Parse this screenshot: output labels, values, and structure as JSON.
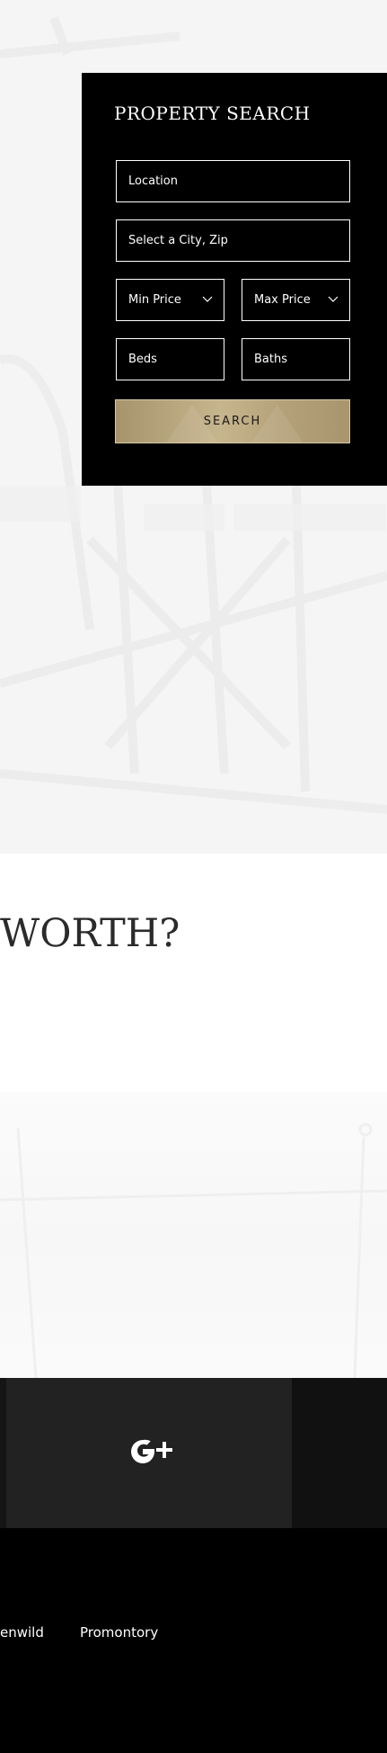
{
  "property_search": {
    "title": "PROPERTY SEARCH",
    "location_label": "Location",
    "city_zip_placeholder": "Select a City, Zip",
    "min_price_label": "Min Price",
    "max_price_label": "Max Price",
    "beds_label": "Beds",
    "baths_label": "Baths",
    "search_button": "SEARCH",
    "accent_color": "#b8a57c"
  },
  "worth_section": {
    "heading_fragment": "WORTH?"
  },
  "social": {
    "icons": [
      "google-plus-icon"
    ]
  },
  "footer": {
    "links": [
      "enwild",
      "Promontory"
    ]
  }
}
